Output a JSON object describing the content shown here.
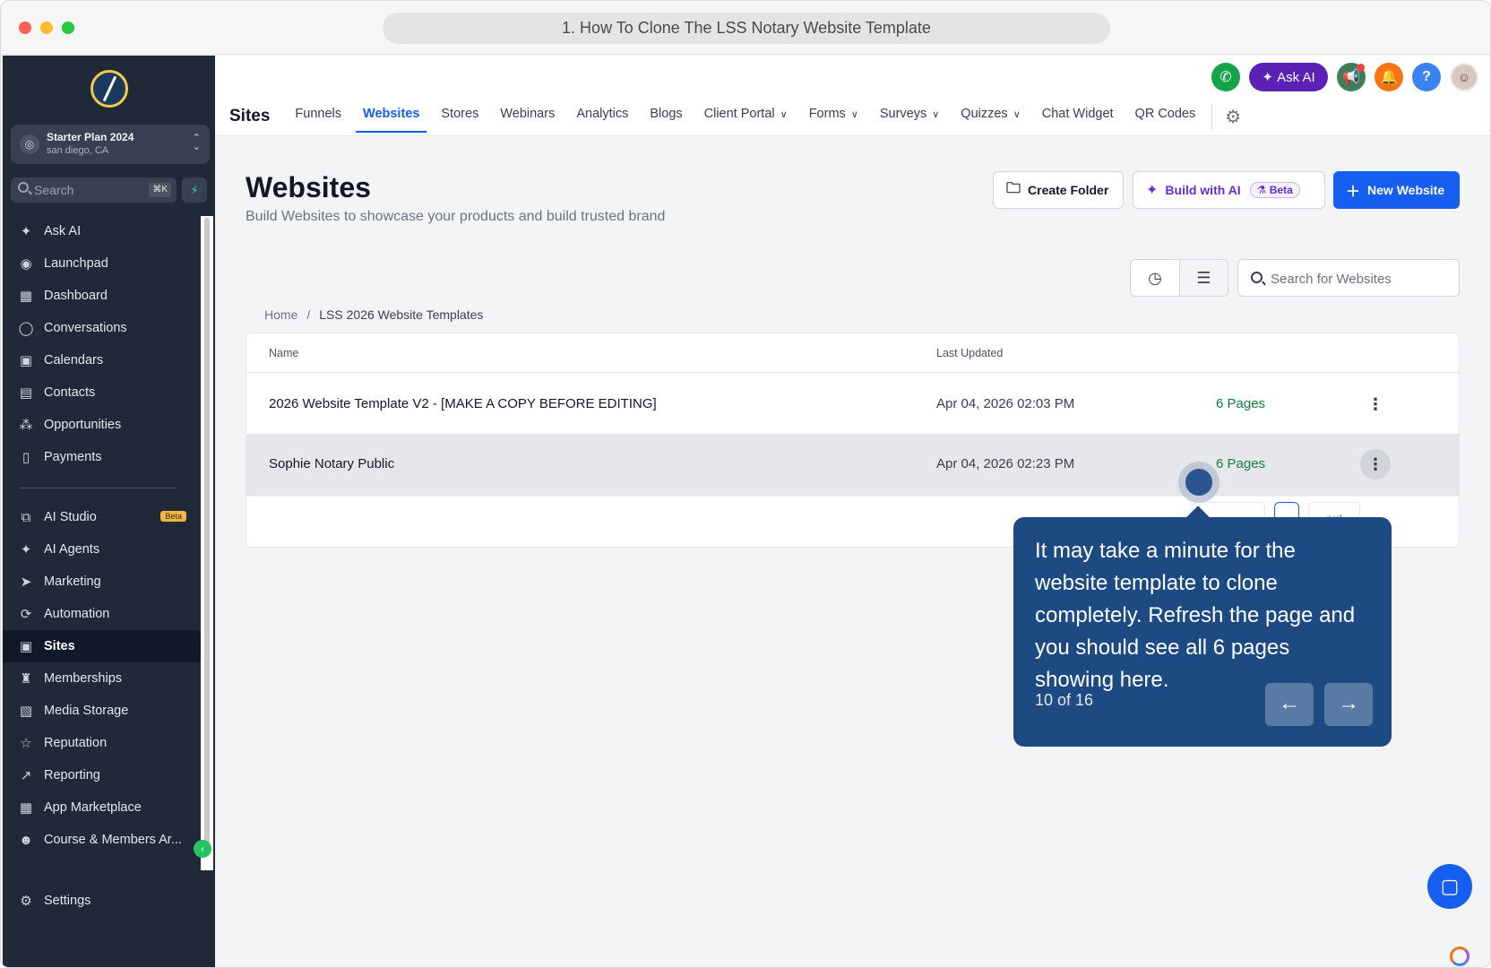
{
  "window": {
    "url_title": "1. How To Clone The LSS Notary Website Template"
  },
  "sidebar": {
    "account_name": "Starter Plan 2024",
    "account_location": "san diego, CA",
    "search_placeholder": "Search",
    "search_shortcut": "⌘K",
    "items": [
      {
        "label": "Ask AI",
        "icon": "sparkle-icon"
      },
      {
        "label": "Launchpad",
        "icon": "rocket-icon"
      },
      {
        "label": "Dashboard",
        "icon": "grid-icon"
      },
      {
        "label": "Conversations",
        "icon": "chat-icon"
      },
      {
        "label": "Calendars",
        "icon": "calendar-icon"
      },
      {
        "label": "Contacts",
        "icon": "contacts-icon"
      },
      {
        "label": "Opportunities",
        "icon": "funnel-icon"
      },
      {
        "label": "Payments",
        "icon": "receipt-icon"
      }
    ],
    "items2": [
      {
        "label": "AI Studio",
        "icon": "ai-studio-icon",
        "badge": "Beta"
      },
      {
        "label": "AI Agents",
        "icon": "sparkle-icon"
      },
      {
        "label": "Marketing",
        "icon": "send-icon"
      },
      {
        "label": "Automation",
        "icon": "automation-icon"
      },
      {
        "label": "Sites",
        "icon": "sites-icon",
        "active": true
      },
      {
        "label": "Memberships",
        "icon": "award-icon"
      },
      {
        "label": "Media Storage",
        "icon": "image-icon"
      },
      {
        "label": "Reputation",
        "icon": "star-icon"
      },
      {
        "label": "Reporting",
        "icon": "trend-icon"
      },
      {
        "label": "App Marketplace",
        "icon": "apps-icon"
      },
      {
        "label": "Course & Members Ar...",
        "icon": "users-icon"
      }
    ],
    "settings_label": "Settings"
  },
  "topbar": {
    "ask_ai_label": "Ask AI",
    "help_label": "?",
    "section_title": "Sites",
    "tabs": [
      {
        "label": "Funnels"
      },
      {
        "label": "Websites",
        "active": true
      },
      {
        "label": "Stores"
      },
      {
        "label": "Webinars"
      },
      {
        "label": "Analytics"
      },
      {
        "label": "Blogs"
      },
      {
        "label": "Client Portal",
        "dropdown": true
      },
      {
        "label": "Forms",
        "dropdown": true
      },
      {
        "label": "Surveys",
        "dropdown": true
      },
      {
        "label": "Quizzes",
        "dropdown": true
      },
      {
        "label": "Chat Widget"
      },
      {
        "label": "QR Codes"
      }
    ]
  },
  "main": {
    "title": "Websites",
    "subtitle": "Build Websites to showcase your products and build trusted brand",
    "create_folder_label": "Create Folder",
    "build_ai_label": "Build with AI",
    "beta_label": "Beta",
    "new_website_label": "New Website",
    "search_placeholder": "Search for Websites",
    "breadcrumb": [
      "Home",
      "LSS 2026 Website Templates"
    ],
    "table": {
      "columns": [
        "Name",
        "Last Updated"
      ],
      "rows": [
        {
          "name": "2026 Website Template V2 - [MAKE A COPY BEFORE EDITING]",
          "updated": "Apr 04, 2026 02:03 PM",
          "pages": "6 Pages"
        },
        {
          "name": "Sophie Notary Public",
          "updated": "Apr 04, 2026 02:23 PM",
          "pages": "6 Pages"
        }
      ],
      "pager_next_partial": "ext"
    }
  },
  "tour": {
    "text": "It may take a minute for the website template to clone completely. Refresh the page and you should see all 6 pages showing here.",
    "counter": "10 of 16"
  },
  "colors": {
    "sidebar_bg": "#1f2937",
    "accent_blue": "#155eef",
    "tour_bg": "#1e4a84",
    "pages_green": "#15803d"
  }
}
